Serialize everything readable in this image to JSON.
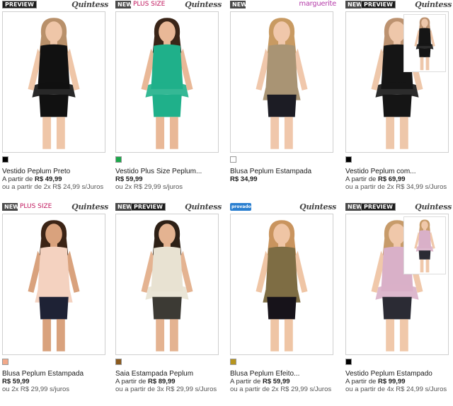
{
  "products": [
    {
      "badges": [
        {
          "label": "PREVIEW",
          "kind": "preview-solo"
        }
      ],
      "brand": "Quintess",
      "swatch_color": "#000000",
      "name": "Vestido Peplum Preto",
      "price_prefix": "A partir de ",
      "price": "R$ 49,99",
      "installments": "ou a partir de 2x R$ 24,99 s/Juros",
      "outfit": {
        "skin": "#efc6a8",
        "hair": "#b8906a",
        "top": "#111111",
        "bottom": "#111111"
      }
    },
    {
      "badges": [
        {
          "label": "NEW",
          "kind": "new"
        },
        {
          "label": "PLUS SIZE",
          "kind": "plus"
        }
      ],
      "brand": "Quintess",
      "swatch_color": "#1aa84a",
      "name": "Vestido Plus Size Peplum...",
      "price_prefix": "",
      "price": "R$ 59,99",
      "installments": "ou 2x R$ 29,99 s/juros",
      "outfit": {
        "skin": "#e9b897",
        "hair": "#3a2518",
        "top": "#1fb08a",
        "bottom": "#1fb08a"
      }
    },
    {
      "badges": [
        {
          "label": "NEW",
          "kind": "new"
        }
      ],
      "brand": "marguerite",
      "swatch_color": "#ffffff",
      "name": "Blusa Peplum Estampada",
      "price_prefix": "",
      "price": "R$ 34,99",
      "installments": "",
      "outfit": {
        "skin": "#f0c7ab",
        "hair": "#c89a62",
        "top": "#a99474",
        "bottom": "#1c1c24"
      }
    },
    {
      "badges": [
        {
          "label": "NEW",
          "kind": "new"
        },
        {
          "label": "PREVIEW",
          "kind": "preview"
        }
      ],
      "brand": "Quintess",
      "swatch_color": "#000000",
      "name": "Vestido Peplum com...",
      "price_prefix": "A partir de ",
      "price": "R$ 69,99",
      "installments": "ou a partir de 2x R$ 34,99 s/Juros",
      "outfit": {
        "skin": "#eec7aa",
        "hair": "#bc9270",
        "top": "#151515",
        "bottom": "#151515"
      }
    },
    {
      "badges": [
        {
          "label": "NEW",
          "kind": "new"
        },
        {
          "label": "PLUS SIZE",
          "kind": "plus"
        }
      ],
      "brand": "Quintess",
      "swatch_color": "#f2a98a",
      "name": "Blusa Peplum Estampada",
      "price_prefix": "",
      "price": "R$ 59,99",
      "installments": "ou 2x R$ 29,99 s/juros",
      "outfit": {
        "skin": "#d9a27d",
        "hair": "#3b2416",
        "top": "#f4d2c0",
        "bottom": "#1e2235"
      }
    },
    {
      "badges": [
        {
          "label": "NEW",
          "kind": "new"
        },
        {
          "label": "PREVIEW",
          "kind": "preview"
        }
      ],
      "brand": "Quintess",
      "swatch_color": "#8b5a1e",
      "name": "Saia Estampada Peplum",
      "price_prefix": "A partir de ",
      "price": "R$ 89,99",
      "installments": "ou a partir de 3x R$ 29,99 s/Juros",
      "outfit": {
        "skin": "#e4b391",
        "hair": "#2d2016",
        "top": "#e8e2d2",
        "bottom": "#3c3a34"
      }
    },
    {
      "badges": [
        {
          "label": "provador virtual",
          "kind": "provador"
        }
      ],
      "brand": "Quintess",
      "swatch_color": "#b8961e",
      "name": "Blusa Peplum Efeito...",
      "price_prefix": "A partir de ",
      "price": "R$ 59,99",
      "installments": "ou a partir de 2x R$ 29,99 s/Juros",
      "outfit": {
        "skin": "#efc5a5",
        "hair": "#c9945e",
        "top": "#7e6d44",
        "bottom": "#17131a"
      }
    },
    {
      "badges": [
        {
          "label": "NEW",
          "kind": "new"
        },
        {
          "label": "PREVIEW",
          "kind": "preview"
        }
      ],
      "brand": "Quintess",
      "swatch_color": "#000000",
      "name": "Vestido Peplum Estampado",
      "price_prefix": "A partir de ",
      "price": "R$ 99,99",
      "installments": "ou a partir de 4x R$ 24,99 s/Juros",
      "outfit": {
        "skin": "#f0c8aa",
        "hair": "#c79b6a",
        "top": "#d9b0c8",
        "bottom": "#2b2b34"
      }
    }
  ]
}
